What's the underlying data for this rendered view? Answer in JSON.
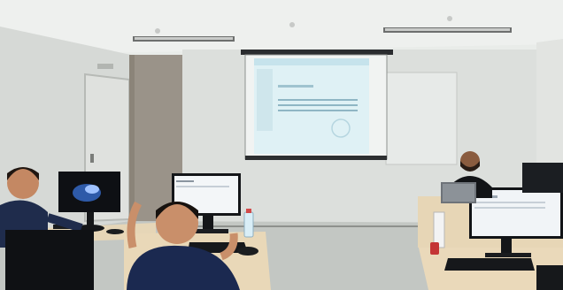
{
  "scene": {
    "description_colors": {
      "wall": "#d9dcd9",
      "ceiling": "#ecefec",
      "floor": "#bfc4c0",
      "pillar": "#9c958c",
      "screen": "#e6f4f6",
      "desk": "#e8d7b6",
      "shirt": "#1d2a4a",
      "monitor": "#111317"
    },
    "icons": [
      "projector-screen-icon",
      "monitor-icon",
      "person-icon",
      "laptop-icon",
      "water-bottle-icon"
    ]
  }
}
